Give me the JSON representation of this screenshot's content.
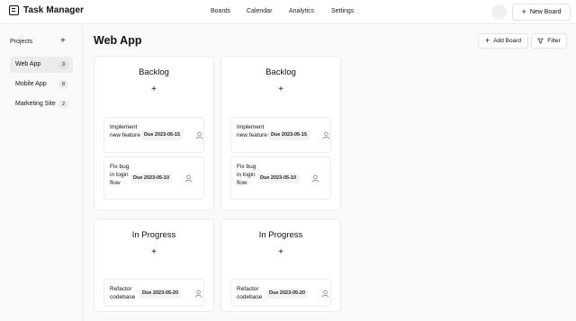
{
  "app": {
    "title": "Task Manager"
  },
  "nav": {
    "items": [
      "Boards",
      "Calendar",
      "Analytics",
      "Settings"
    ]
  },
  "header": {
    "new_board_label": "New Board"
  },
  "sidebar": {
    "heading": "Projects",
    "add_symbol": "+",
    "items": [
      {
        "label": "Web App",
        "count": "3",
        "active": true
      },
      {
        "label": "Mobile App",
        "count": "8",
        "active": false
      },
      {
        "label": "Marketing Site",
        "count": "2",
        "active": false
      }
    ]
  },
  "main": {
    "title": "Web App",
    "add_board_label": "Add Board",
    "filter_label": "Filter"
  },
  "boards": [
    {
      "title": "Backlog",
      "add_symbol": "+",
      "tasks": [
        {
          "name": "Implement new feature",
          "due": "Due 2023-05-15"
        },
        {
          "name": "Fix bug in login flow",
          "due": "Due 2023-05-10"
        }
      ]
    },
    {
      "title": "Backlog",
      "add_symbol": "+",
      "tasks": [
        {
          "name": "Implement new feature",
          "due": "Due 2023-05-15"
        },
        {
          "name": "Fix bug in login flow",
          "due": "Due 2023-05-10"
        }
      ]
    },
    {
      "title": "In Progress",
      "add_symbol": "+",
      "tasks": [
        {
          "name": "Refactor codebase",
          "due": "Due 2023-05-20"
        }
      ]
    },
    {
      "title": "In Progress",
      "add_symbol": "+",
      "tasks": [
        {
          "name": "Refactor codebase",
          "due": "Due 2023-05-20"
        }
      ]
    }
  ],
  "icons": {
    "logo": "task-list-icon",
    "plus": "plus-icon",
    "filter": "funnel-icon",
    "assignee": "person-icon"
  }
}
